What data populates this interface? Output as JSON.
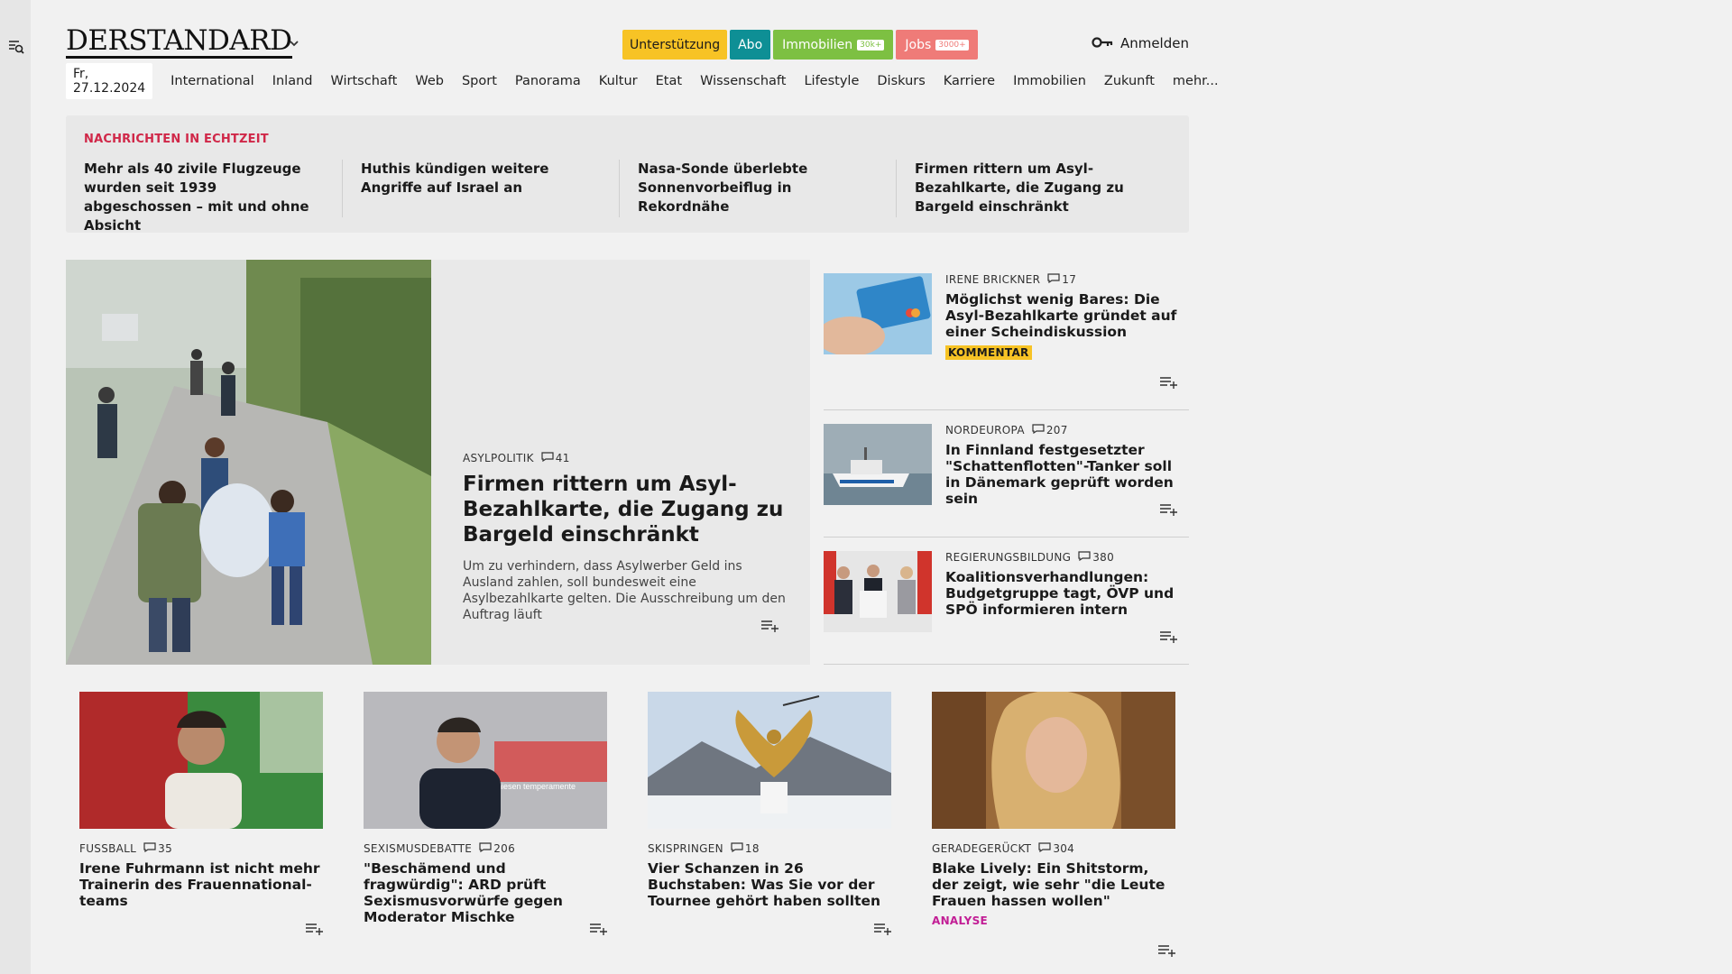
{
  "header": {
    "logo": "DERSTANDARD",
    "pills": {
      "support": "Unterstützung",
      "abo": "Abo",
      "immobilien": "Immobilien",
      "immobilien_badge": "30k+",
      "jobs": "Jobs",
      "jobs_badge": "3000+"
    },
    "login": "Anmelden"
  },
  "nav": {
    "date": "Fr, 27.12.2024",
    "items": [
      "International",
      "Inland",
      "Wirtschaft",
      "Web",
      "Sport",
      "Panorama",
      "Kultur",
      "Etat",
      "Wissenschaft",
      "Lifestyle",
      "Diskurs",
      "Karriere",
      "Immobilien",
      "Zukunft",
      "mehr..."
    ]
  },
  "live": {
    "label": "NACHRICHTEN IN ECHTZEIT",
    "items": [
      "Mehr als 40 zivile Flugzeuge wurden seit 1939 abgeschossen – mit und ohne Absicht",
      "Huthis kündigen weitere Angriffe auf Israel an",
      "Nasa-Sonde überlebte Sonnenvorbei­flug in Rekordnähe",
      "Firmen rittern um Asyl-Bezahlkarte, die Zugang zu Bargeld einschränkt"
    ]
  },
  "hero": {
    "kicker": "ASYLPOLITIK",
    "comments": "41",
    "title": "Firmen rittern um Asyl-Bezahl­karte, die Zugang zu Bargeld einschränkt",
    "lead": "Um zu verhindern, dass Asylwerber Geld ins Ausland zahlen, soll bundesweit eine Asylbezahlkarte gelten. Die Ausschreibung um den Auftrag läuft"
  },
  "side": [
    {
      "kicker": "IRENE BRICKNER",
      "comments": "17",
      "title": "Möglichst wenig Bares: Die Asyl-Bezahlkarte gründet auf einer Scheindiskussion",
      "tag": "KOMMENTAR"
    },
    {
      "kicker": "NORDEUROPA",
      "comments": "207",
      "title": "In Finnland festgesetzter \"Schat­tenflotten\"-Tanker soll in Dänemark geprüft worden sein",
      "tag": ""
    },
    {
      "kicker": "REGIERUNGSBILDUNG",
      "comments": "380",
      "title": "Koalitionsverhandlungen: Budgetgruppe tagt, ÖVP und SPÖ informieren intern",
      "tag": ""
    }
  ],
  "cards": [
    {
      "kicker": "FUSSBALL",
      "comments": "35",
      "title": "Irene Fuhrmann ist nicht mehr Trainerin des Frauennational­teams",
      "tag": ""
    },
    {
      "kicker": "SEXISMUSDEBATTE",
      "comments": "206",
      "title": "\"Beschämend und fragwürdig\": ARD prüft Sexismusvorwürfe gegen Moderator Mischke",
      "tag": ""
    },
    {
      "kicker": "SKISPRINGEN",
      "comments": "18",
      "title": "Vier Schanzen in 26 Buchstaben: Was Sie vor der Tournee gehört haben sollten",
      "tag": ""
    },
    {
      "kicker": "GERADEGERÜCKT",
      "comments": "304",
      "title": "Blake Lively: Ein Shitstorm, der zeigt, wie sehr \"die Leute Frauen hassen wollen\"",
      "tag": "ANALYSE"
    }
  ],
  "image_texts": {
    "card2_banner": "niesen temperamente"
  },
  "colors": {
    "live_label": "#d02748",
    "support": "#f7c325",
    "abo": "#0e8f95",
    "immobilien": "#7dc042",
    "jobs": "#ef7b78",
    "analyse": "#c21e95"
  }
}
